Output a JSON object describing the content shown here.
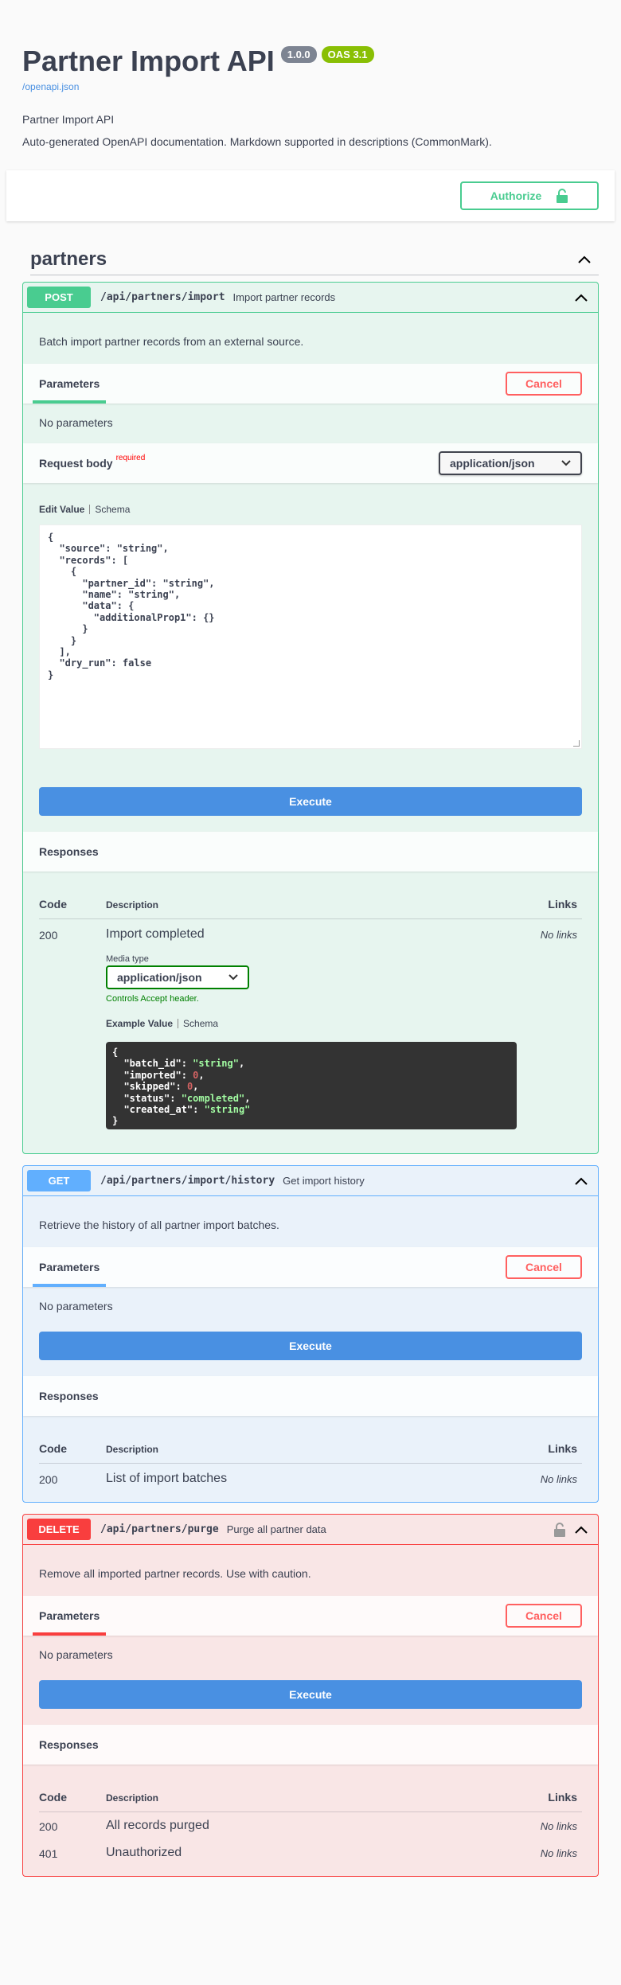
{
  "info": {
    "title": "Partner Import API",
    "version": "1.0.0",
    "oas": "OAS 3.1",
    "spec_url": "/openapi.json",
    "summary": "Partner Import API",
    "description": "Auto-generated OpenAPI documentation. Markdown supported in descriptions (CommonMark)."
  },
  "auth": {
    "label": "Authorize"
  },
  "tag": {
    "name": "partners"
  },
  "labels": {
    "parameters": "Parameters",
    "cancel": "Cancel",
    "no_params": "No parameters",
    "request_body": "Request body",
    "required": "required",
    "edit_value": "Edit Value",
    "schema": "Schema",
    "execute": "Execute",
    "responses": "Responses",
    "code": "Code",
    "description": "Description",
    "links": "Links",
    "no_links": "No links",
    "media_type": "Media type",
    "controls_accept": "Controls Accept header.",
    "example_value": "Example Value"
  },
  "ops": {
    "post": {
      "method": "POST",
      "path": "/api/partners/import",
      "summary": "Import partner records",
      "description": "Batch import partner records from an external source.",
      "content_type": "application/json",
      "body": "{\n  \"source\": \"string\",\n  \"records\": [\n    {\n      \"partner_id\": \"string\",\n      \"name\": \"string\",\n      \"data\": {\n        \"additionalProp1\": {}\n      }\n    }\n  ],\n  \"dry_run\": false\n}",
      "responses": [
        {
          "code": "200",
          "description": "Import completed",
          "media_type": "application/json"
        }
      ]
    },
    "get": {
      "method": "GET",
      "path": "/api/partners/import/history",
      "summary": "Get import history",
      "description": "Retrieve the history of all partner import batches.",
      "responses": [
        {
          "code": "200",
          "description": "List of import batches"
        }
      ]
    },
    "del": {
      "method": "DELETE",
      "path": "/api/partners/purge",
      "summary": "Purge all partner data",
      "description": "Remove all imported partner records. Use with caution.",
      "responses": [
        {
          "code": "200",
          "description": "All records purged"
        },
        {
          "code": "401",
          "description": "Unauthorized"
        }
      ]
    }
  },
  "example": {
    "batch_id_key": "\"batch_id\"",
    "batch_id_val": "\"string\"",
    "imported_key": "\"imported\"",
    "imported_val": "0",
    "skipped_key": "\"skipped\"",
    "skipped_val": "0",
    "status_key": "\"status\"",
    "status_val": "\"completed\"",
    "created_at_key": "\"created_at\"",
    "created_at_val": "\"string\""
  },
  "colors": {
    "post": "#49cc90",
    "get": "#61affe",
    "delete": "#f93e3e",
    "execute": "#4990e2"
  }
}
